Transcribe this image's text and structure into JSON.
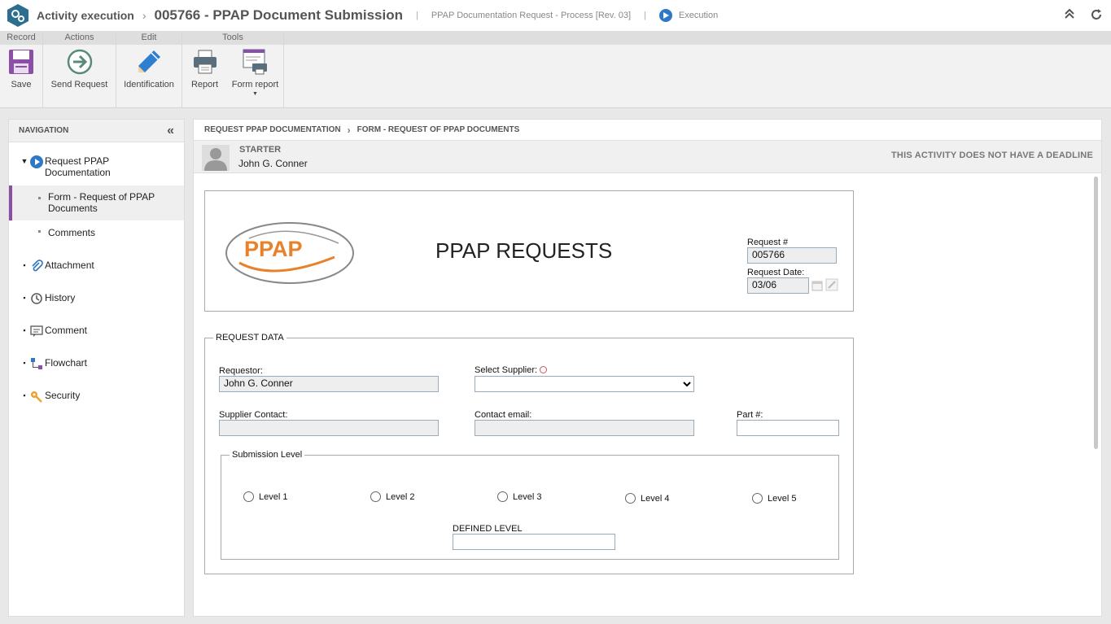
{
  "titlebar": {
    "app_name": "Activity execution",
    "record_title": "005766 - PPAP Document Submission",
    "process": "PPAP Documentation Request - Process [Rev. 03]",
    "status": "Execution"
  },
  "ribbon": {
    "groups": {
      "record": "Record",
      "actions": "Actions",
      "edit": "Edit",
      "tools": "Tools"
    },
    "buttons": {
      "save": "Save",
      "send_request": "Send Request",
      "identification": "Identification",
      "report": "Report",
      "form_report": "Form report"
    }
  },
  "navigation": {
    "title": "NAVIGATION",
    "items": {
      "request": "Request PPAP Documentation",
      "form": "Form - Request of PPAP Documents",
      "comments": "Comments",
      "attachment": "Attachment",
      "history": "History",
      "comment": "Comment",
      "flowchart": "Flowchart",
      "security": "Security"
    }
  },
  "main": {
    "breadcrumb_1": "REQUEST PPAP DOCUMENTATION",
    "breadcrumb_2": "FORM - REQUEST OF PPAP DOCUMENTS",
    "starter_label": "STARTER",
    "starter_name": "John G. Conner",
    "deadline": "THIS ACTIVITY DOES NOT HAVE A DEADLINE"
  },
  "form": {
    "logo_text": "PPAP",
    "title": "PPAP REQUESTS",
    "request_num_label": "Request #",
    "request_num": "005766",
    "request_date_label": "Request Date:",
    "request_date": "03/06",
    "request_data_legend": "REQUEST DATA",
    "requestor_label": "Requestor:",
    "requestor": "John G. Conner",
    "supplier_label": "Select Supplier:",
    "supplier_value": "",
    "supplier_contact_label": "Supplier Contact:",
    "supplier_contact": "",
    "contact_email_label": "Contact email:",
    "contact_email": "",
    "part_label": "Part #:",
    "part": "",
    "submission_legend": "Submission Level",
    "levels": [
      "Level 1",
      "Level 2",
      "Level 3",
      "Level 4",
      "Level 5"
    ],
    "defined_level_label": "DEFINED LEVEL",
    "defined_level": ""
  }
}
